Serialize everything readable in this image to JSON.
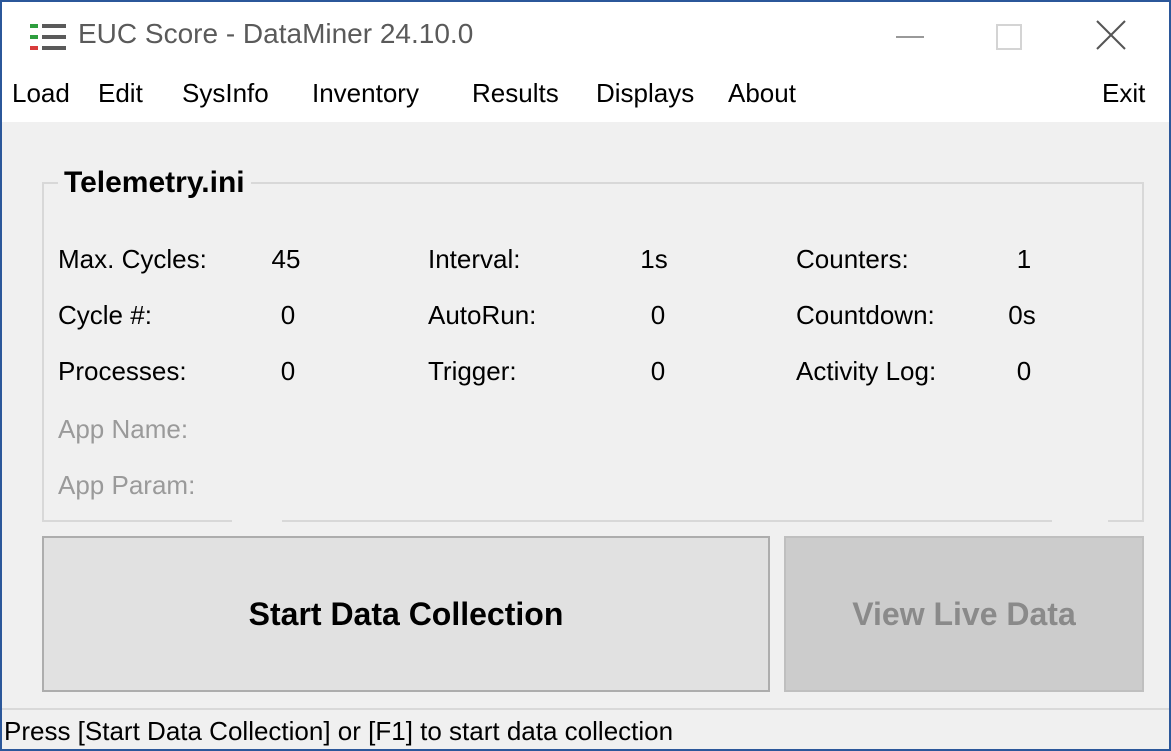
{
  "window": {
    "title": "EUC Score - DataMiner 24.10.0",
    "icon": "list-icon",
    "controls": {
      "minimize": "minimize-icon",
      "maximize": "maximize-icon",
      "close": "close-icon"
    }
  },
  "menu": {
    "load": "Load",
    "edit": "Edit",
    "sysinfo": "SysInfo",
    "inventory": "Inventory",
    "results": "Results",
    "displays": "Displays",
    "about": "About",
    "exit": "Exit"
  },
  "config": {
    "title": "Telemetry.ini",
    "max_cycles_label": "Max. Cycles:",
    "max_cycles": "45",
    "interval_label": "Interval:",
    "interval": "1s",
    "counters_label": "Counters:",
    "counters": "1",
    "cycle_label": "Cycle #:",
    "cycle": "0",
    "autorun_label": "AutoRun:",
    "autorun": "0",
    "countdown_label": "Countdown:",
    "countdown": "0s",
    "processes_label": "Processes:",
    "processes": "0",
    "trigger_label": "Trigger:",
    "trigger": "0",
    "activity_log_label": "Activity Log:",
    "activity_log": "0",
    "app_name_label": "App Name:",
    "app_param_label": "App Param:"
  },
  "buttons": {
    "start": "Start Data Collection",
    "live": "View Live Data"
  },
  "status": {
    "text": "Press [Start Data Collection] or [F1] to start data collection"
  },
  "colors": {
    "window_border": "#2b579a",
    "icon_green": "#2e9e3e",
    "icon_red": "#d83b3b",
    "disabled_text": "#8a8a8a"
  }
}
